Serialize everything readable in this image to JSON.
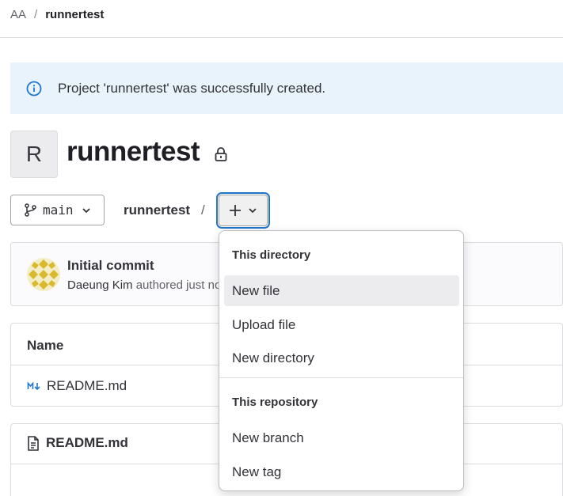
{
  "breadcrumb": {
    "root": "AA",
    "separator": "/",
    "current": "runnertest"
  },
  "alert": {
    "message": "Project 'runnertest' was successfully created.",
    "icon": "info-icon"
  },
  "project": {
    "avatar_letter": "R",
    "name": "runnertest",
    "visibility_icon": "lock-icon"
  },
  "toolbar": {
    "branch": "main",
    "path": "runnertest",
    "path_separator": "/",
    "add_icon": "plus-icon"
  },
  "commit": {
    "title": "Initial commit",
    "author": "Daeung Kim",
    "meta_suffix": "authored just now"
  },
  "files": {
    "column_name": "Name",
    "rows": [
      {
        "name": "README.md",
        "icon": "markdown-icon"
      }
    ]
  },
  "readme": {
    "title": "README.md",
    "icon": "doc-icon"
  },
  "dropdown": {
    "section_1_header": "This directory",
    "section_1_items": [
      "New file",
      "Upload file",
      "New directory"
    ],
    "section_2_header": "This repository",
    "section_2_items": [
      "New branch",
      "New tag"
    ],
    "active_item": "New file"
  },
  "colors": {
    "alert_bg": "#e9f3fc",
    "info_blue": "#1f75cb",
    "focus_ring": "#1f75cb",
    "active_item_bg": "#ececef"
  }
}
